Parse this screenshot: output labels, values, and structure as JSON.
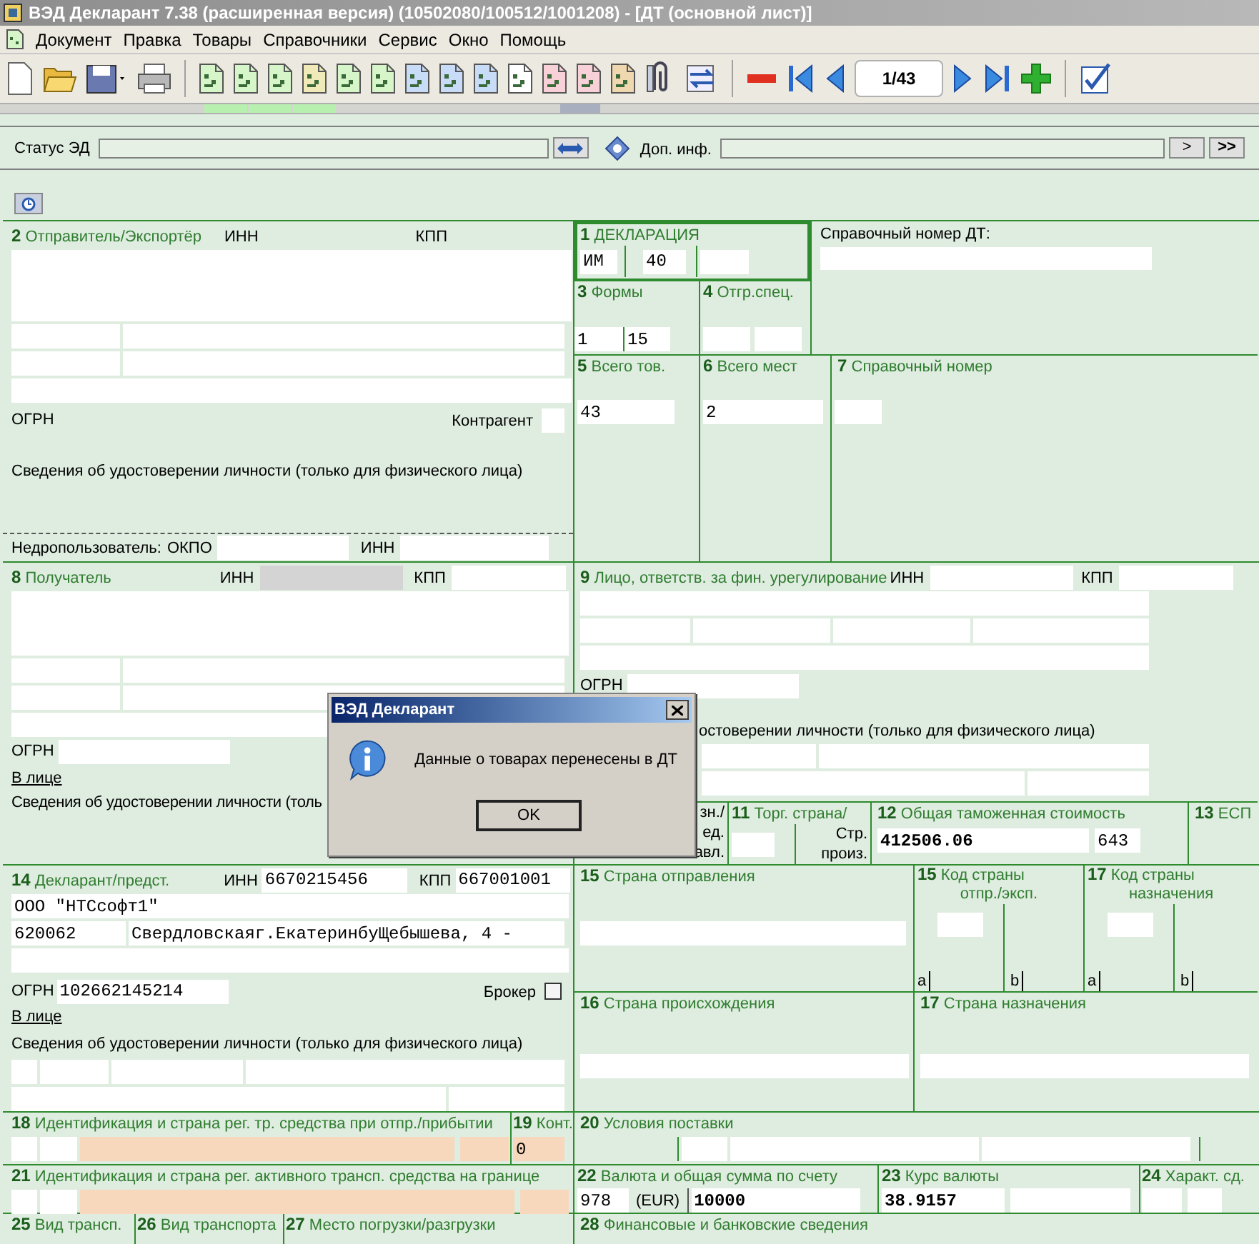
{
  "window": {
    "title": "ВЭД Декларант 7.38 (расширенная версия) (10502080/100512/1001208) - [ДТ (основной лист)]"
  },
  "menu": [
    "Документ",
    "Правка",
    "Товары",
    "Справочники",
    "Сервис",
    "Окно",
    "Помощь"
  ],
  "toolbar": {
    "page": "1/43"
  },
  "status_row": {
    "status_label": "Статус ЭД",
    "extra_label": "Доп. инф.",
    "next": ">",
    "last": ">>"
  },
  "form": {
    "box2": {
      "num": "2",
      "title": "Отправитель/Экспортёр",
      "inn_label": "ИНН",
      "kpp_label": "КПП",
      "ogrn_label": "ОГРН",
      "counterpart_label": "Контрагент",
      "id_note": "Сведения об удостоверении личности (только для физического лица)"
    },
    "subsoil": {
      "label": "Недропользователь:",
      "okpo_label": "ОКПО",
      "inn_label": "ИНН"
    },
    "box8": {
      "num": "8",
      "title": "Получатель",
      "inn_label": "ИНН",
      "kpp_label": "КПП",
      "ogrn_label": "ОГРН",
      "person_link": "В лице",
      "id_note": "Сведения об удостоверении личности (толь"
    },
    "box1": {
      "num": "1",
      "title": "ДЕКЛАРАЦИЯ",
      "values": [
        "ИМ",
        "40"
      ]
    },
    "ref_dt": {
      "label": "Справочный номер ДТ:"
    },
    "box3": {
      "num": "3",
      "title": "Формы",
      "values": [
        "1",
        "15"
      ]
    },
    "box4": {
      "num": "4",
      "title": "Отгр.спец."
    },
    "box5": {
      "num": "5",
      "title": "Всего тов.",
      "value": "43"
    },
    "box6": {
      "num": "6",
      "title": "Всего мест",
      "value": "2"
    },
    "box7": {
      "num": "7",
      "title": "Справочный номер"
    },
    "box9": {
      "num": "9",
      "title": "Лицо, ответств. за фин. урегулирование",
      "inn_label": "ИНН",
      "kpp_label": "КПП",
      "ogrn_label": "ОГРН",
      "id_note": "остоверении личности (только для физического лица)"
    },
    "box10": {
      "lines": [
        "зн./",
        "ед.",
        "авл."
      ]
    },
    "box11": {
      "num": "11",
      "title": "Торг. страна/",
      "lines": [
        "Стр.",
        "произ."
      ]
    },
    "box12": {
      "num": "12",
      "title": "Общая таможенная стоимость",
      "value": "412506.06",
      "currency": "643"
    },
    "box13": {
      "num": "13",
      "title": "ЕСП"
    },
    "box14": {
      "num": "14",
      "title": "Декларант/предст.",
      "inn_label": "ИНН",
      "inn": "6670215456",
      "kpp_label": "КПП",
      "kpp": "667001001",
      "name": "ООО \"НТСсофт1\"",
      "zip": "620062",
      "region": "Свердловская",
      "city": "г.Екатеринбу",
      "street": "Щебышева, 4 -",
      "ogrn_label": "ОГРН",
      "ogrn": "102662145214",
      "broker_label": "Брокер",
      "broker_checked": false,
      "person_link": "В лице",
      "id_note": "Сведения об удостоверении личности (только для физического лица)"
    },
    "box15": {
      "num": "15",
      "title": "Страна отправления"
    },
    "box15a": {
      "num": "15",
      "title_lines": [
        "Код страны",
        "отпр./эксп."
      ],
      "sub": [
        "a",
        "b"
      ]
    },
    "box17a": {
      "num": "17",
      "title_lines": [
        "Код страны",
        "назначения"
      ],
      "sub": [
        "a",
        "b"
      ]
    },
    "box16": {
      "num": "16",
      "title": "Страна происхождения"
    },
    "box17": {
      "num": "17",
      "title": "Страна назначения"
    },
    "box18": {
      "num": "18",
      "title": "Идентификация и страна рег. тр. средства при отпр./прибытии"
    },
    "box19": {
      "num": "19",
      "title": "Конт.",
      "value": "0"
    },
    "box20": {
      "num": "20",
      "title": "Условия поставки"
    },
    "box21": {
      "num": "21",
      "title": "Идентификация и страна рег. активного трансп. средства на границе"
    },
    "box22": {
      "num": "22",
      "title": "Валюта и общая сумма по счету",
      "code": "978",
      "currency": "(EUR)",
      "value": "10000"
    },
    "box23": {
      "num": "23",
      "title": "Курс валюты",
      "value": "38.9157"
    },
    "box24": {
      "num": "24",
      "title": "Характ. сд."
    },
    "box25": {
      "num": "25",
      "title": "Вид трансп."
    },
    "box26": {
      "num": "26",
      "title": "Вид транспорта"
    },
    "box27": {
      "num": "27",
      "title": "Место погрузки/разгрузки"
    },
    "box28": {
      "num": "28",
      "title": "Финансовые и банковские сведения"
    }
  },
  "dialog": {
    "title": "ВЭД Декларант",
    "message": "Данные о товарах перенесены в ДТ",
    "button": "OK"
  }
}
